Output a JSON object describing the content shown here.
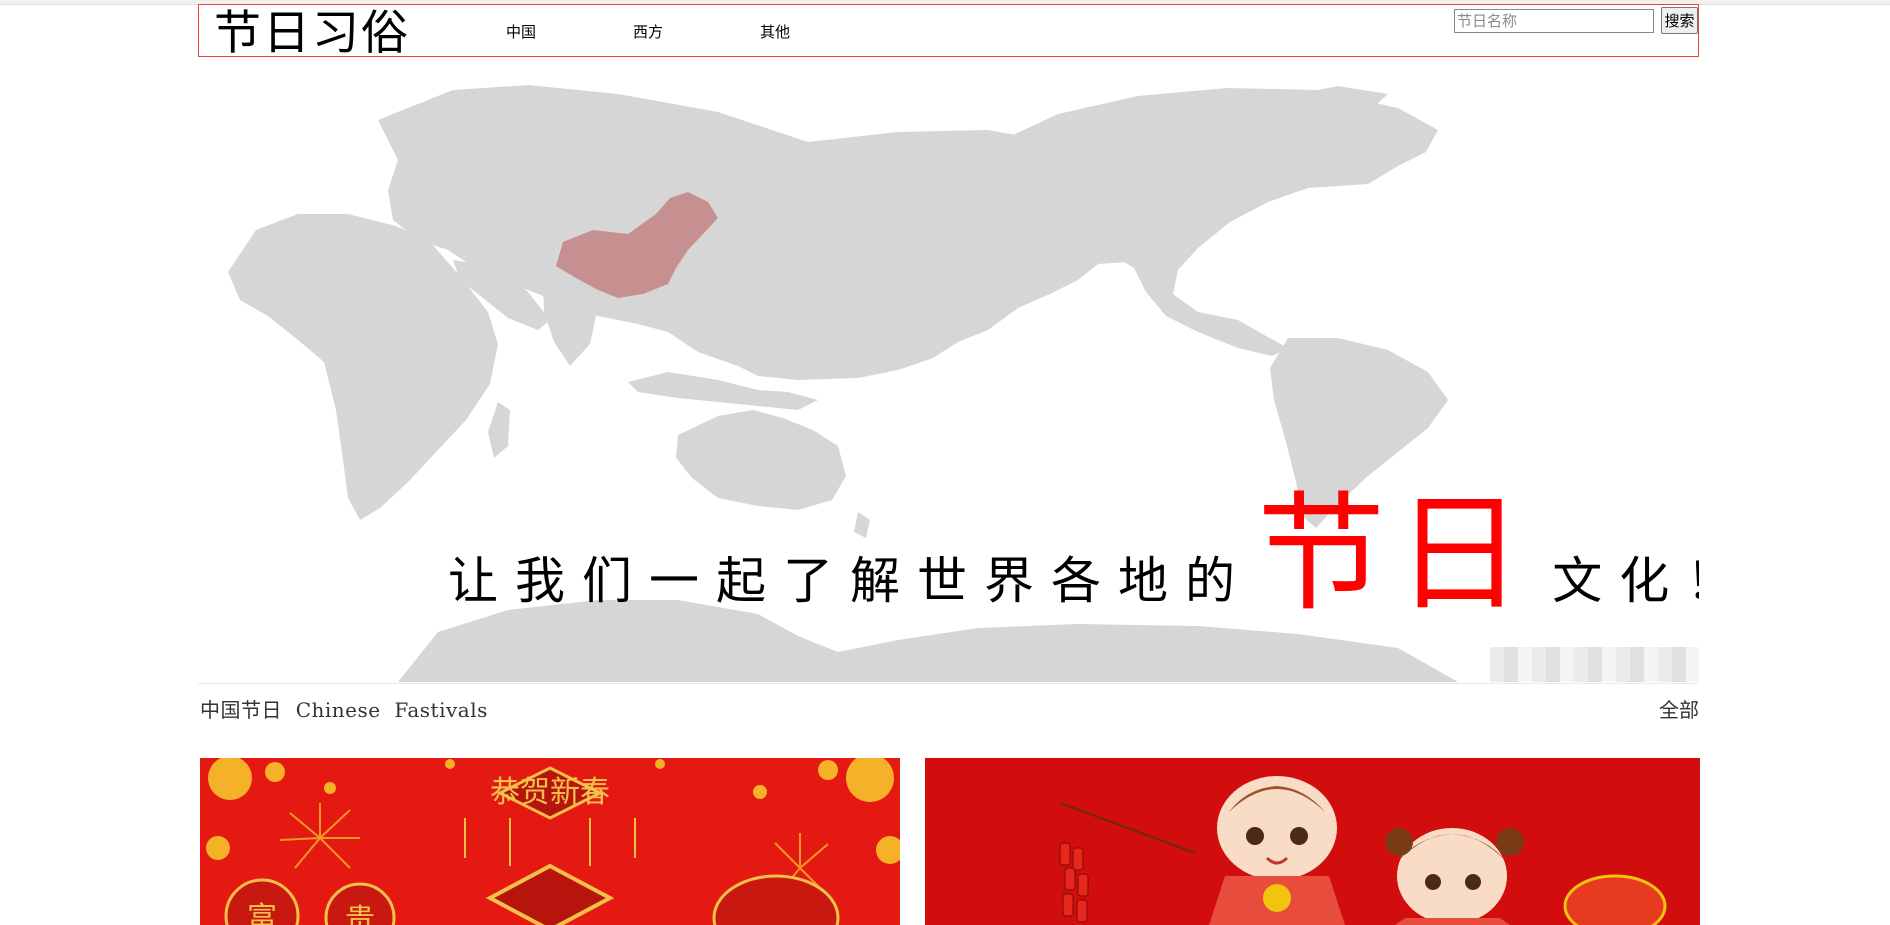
{
  "site": {
    "logo": "节日习俗"
  },
  "nav": {
    "items": [
      {
        "label": "中国"
      },
      {
        "label": "西方"
      },
      {
        "label": "其他"
      }
    ]
  },
  "search": {
    "placeholder": "节日名称",
    "button_label": "搜索"
  },
  "hero": {
    "slogan_before": "让我们一起了解世界各地的",
    "slogan_highlight": "节日",
    "slogan_after": "文化！",
    "highlight_color": "#ff0000"
  },
  "section": {
    "title": "中国节日  Chinese  Fastivals",
    "more_label": "全部"
  },
  "cards": [
    {
      "banner_text": "恭贺新春",
      "chars": [
        "富",
        "贵"
      ]
    },
    {
      "banner_text": ""
    }
  ],
  "colors": {
    "header_border": "#e8423f",
    "map_land": "#d6d6d6",
    "china": "#c79090",
    "card_red": "#e41a12"
  }
}
